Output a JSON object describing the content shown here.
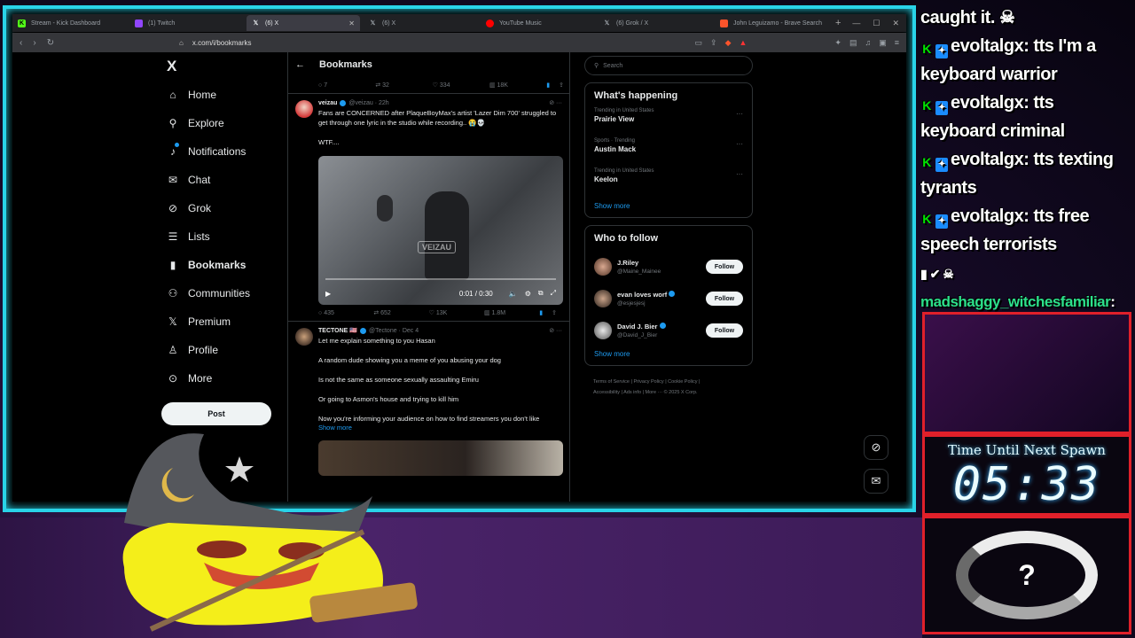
{
  "browser": {
    "tabs": [
      {
        "label": "Stream - Kick Dashboard",
        "icon": "kick-icon",
        "color": "#53fc18",
        "active": false
      },
      {
        "label": "(1) Twitch",
        "icon": "twitch-icon",
        "color": "#9146ff",
        "active": false
      },
      {
        "label": "(6) X",
        "icon": "x-icon",
        "color": "#ffffff",
        "active": true
      },
      {
        "label": "(6) X",
        "icon": "x-icon",
        "color": "#ffffff",
        "active": false
      },
      {
        "label": "YouTube Music",
        "icon": "youtube-music-icon",
        "color": "#ff0000",
        "active": false
      },
      {
        "label": "(6) Grok / X",
        "icon": "x-icon",
        "color": "#ffffff",
        "active": false
      },
      {
        "label": "John Leguizamo - Brave Search",
        "icon": "brave-icon",
        "color": "#fb542b",
        "active": false
      }
    ],
    "url": "x.com/i/bookmarks"
  },
  "sidebar": {
    "logo": "X",
    "items": [
      {
        "label": "Home",
        "icon": "home-icon"
      },
      {
        "label": "Explore",
        "icon": "search-icon"
      },
      {
        "label": "Notifications",
        "icon": "bell-icon"
      },
      {
        "label": "Chat",
        "icon": "mail-icon"
      },
      {
        "label": "Grok",
        "icon": "grok-icon"
      },
      {
        "label": "Lists",
        "icon": "list-icon"
      },
      {
        "label": "Bookmarks",
        "icon": "bookmark-icon"
      },
      {
        "label": "Communities",
        "icon": "people-icon"
      },
      {
        "label": "Premium",
        "icon": "x-icon"
      },
      {
        "label": "Profile",
        "icon": "person-icon"
      },
      {
        "label": "More",
        "icon": "more-icon"
      }
    ],
    "post_label": "Post"
  },
  "feed": {
    "title": "Bookmarks",
    "top_actions": {
      "replies": "7",
      "reposts": "32",
      "likes": "334",
      "views": "18K"
    },
    "tweet1": {
      "name": "veizau",
      "handle": "@veizau · 22h",
      "text": "Fans are CONCERNED after PlaqueBoyMax's artist 'Lazer Dim 700' struggled to get through one lyric in the studio while recording.. 😭💀",
      "text2": "WTF....",
      "video_watermark": "VEIZAU",
      "video_time": "0:01 / 0:30",
      "replies": "435",
      "reposts": "652",
      "likes": "13K",
      "views": "1.8M"
    },
    "tweet2": {
      "name": "TECTONE 🇺🇸",
      "handle": "@Tectone · Dec 4",
      "lines": [
        "Let me explain something to you Hasan",
        "A random dude showing you a meme of you abusing your dog",
        "Is not the same as someone sexually assaulting Emiru",
        "Or going to Asmon's house and trying to kill him",
        "Now you're informing your audience on how to find streamers you don't like"
      ],
      "show_more": "Show more"
    }
  },
  "right": {
    "search_placeholder": "Search",
    "happening_title": "What's happening",
    "trends": [
      {
        "context": "Trending in United States",
        "name": "Prairie View"
      },
      {
        "context": "Sports · Trending",
        "name": "Austin Mack"
      },
      {
        "context": "Trending in United States",
        "name": "Keelon"
      }
    ],
    "show_more": "Show more",
    "follow_title": "Who to follow",
    "follows": [
      {
        "name": "J.Riley",
        "handle": "@Maine_Mainee",
        "button": "Follow"
      },
      {
        "name": "evan loves worf",
        "handle": "@esjesjesj",
        "button": "Follow"
      },
      {
        "name": "David J. Bier",
        "handle": "@David_J_Bier",
        "button": "Follow"
      }
    ],
    "follow_show_more": "Show more",
    "footer1": "Terms of Service  |  Privacy Policy  |  Cookie Policy  |",
    "footer2": "Accessibility  |  Ads info  |  More ···  © 2025 X Corp."
  },
  "chat": {
    "messages": [
      {
        "user": "",
        "text": "caught it."
      },
      {
        "user": "evoltalgx",
        "text": ": tts I'm a keyboard warrior"
      },
      {
        "user": "evoltalgx",
        "text": ": tts keyboard criminal"
      },
      {
        "user": "evoltalgx",
        "text": ": tts texting tyrants"
      },
      {
        "user": "evoltalgx",
        "text": ": tts free speech terrorists"
      },
      {
        "user": "madshaggy_witchesfamiliar",
        "text": ":"
      }
    ]
  },
  "overlay": {
    "spawn_label": "Time Until Next Spawn",
    "spawn_clock": "05:33"
  }
}
